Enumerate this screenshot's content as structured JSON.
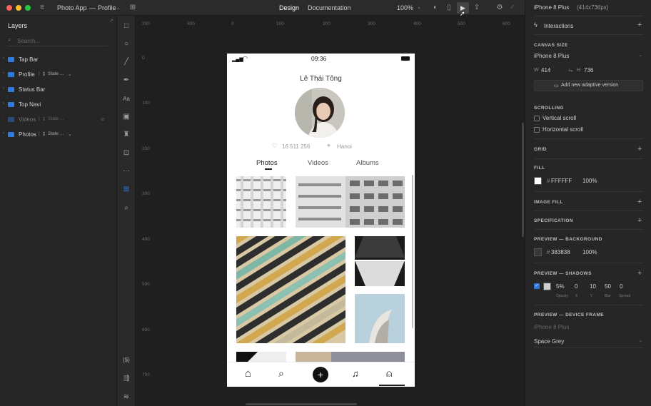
{
  "titlebar": {
    "breadcrumb_app": "Photo App",
    "breadcrumb_sep": "—",
    "breadcrumb_page": "Profile",
    "tabs": [
      "Design",
      "Documentation"
    ],
    "zoom": "100%"
  },
  "layers_panel": {
    "title": "Layers",
    "search_placeholder": "Search...",
    "items": [
      {
        "label": "Tap Bar",
        "state": ""
      },
      {
        "label": "Profile",
        "state": "State ..."
      },
      {
        "label": "Status Bar",
        "state": ""
      },
      {
        "label": "Top Navi",
        "state": ""
      },
      {
        "label": "Videos",
        "state": "State ..."
      },
      {
        "label": "Photos",
        "state": "State ..."
      }
    ]
  },
  "rulers": {
    "x": [
      "-200",
      "-100",
      "0",
      "100",
      "200",
      "300",
      "400",
      "500",
      "600"
    ],
    "x_top": [
      "200",
      "400",
      "0",
      "100",
      "200",
      "300",
      "400",
      "500",
      "600"
    ],
    "y": [
      "0",
      "100",
      "200",
      "300",
      "400",
      "500",
      "600",
      "700"
    ]
  },
  "phone": {
    "time": "09:36",
    "name": "Lê Thái Tông",
    "likes": "16 511 256",
    "location": "Hanoi",
    "tabs": [
      "Photos",
      "Videos",
      "Albums"
    ]
  },
  "inspector": {
    "device": "iPhone 8 Plus",
    "device_size": "(414x736px)",
    "interactions": "Interactions",
    "canvas_size_h": "CANVAS SIZE",
    "canvas_device": "iPhone 8 Plus",
    "w_label": "W",
    "w_value": "414",
    "h_label": "H",
    "h_value": "736",
    "adaptive_button": "Add new adaptive version",
    "scrolling_h": "SCROLLING",
    "vertical_scroll": "Vertical scroll",
    "horizontal_scroll": "Horizontal scroll",
    "grid_h": "GRID",
    "fill_h": "FILL",
    "fill_hex": "FFFFFF",
    "fill_opacity": "100%",
    "image_fill_h": "IMAGE FILL",
    "specification_h": "SPECIFICATION",
    "preview_bg_h": "PREVIEW — BACKGROUND",
    "bg_hex": "383838",
    "bg_opacity": "100%",
    "preview_shadows_h": "PREVIEW — SHADOWS",
    "shadow_values": [
      "5%",
      "0",
      "10",
      "50",
      "0"
    ],
    "shadow_labels": [
      "Opacity",
      "X",
      "Y",
      "Blur",
      "Spread"
    ],
    "preview_frame_h": "PREVIEW — DEVICE FRAME",
    "frame_device": "iPhone 8 Plus",
    "frame_color": "Space Grey"
  },
  "colors": {
    "accent": "#2d7be0",
    "panel": "#262626",
    "canvas": "#1f1f1f"
  }
}
